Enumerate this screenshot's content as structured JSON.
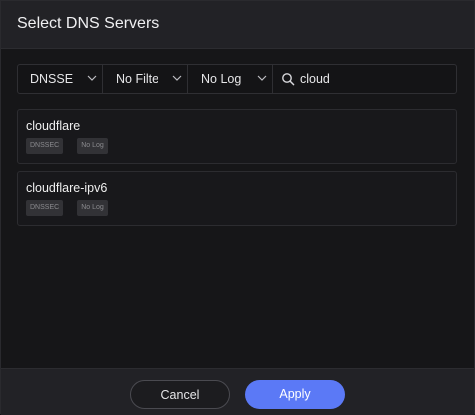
{
  "dialog": {
    "title": "Select DNS Servers"
  },
  "filters": {
    "dnssec": "DNSSE",
    "filter": "No Filte",
    "log": "No Log",
    "search_value": "cloud"
  },
  "servers": [
    {
      "name": "cloudflare",
      "badges": [
        "DNSSEC",
        "No Log"
      ]
    },
    {
      "name": "cloudflare-ipv6",
      "badges": [
        "DNSSEC",
        "No Log"
      ]
    }
  ],
  "footer": {
    "cancel_label": "Cancel",
    "apply_label": "Apply"
  },
  "colors": {
    "accent": "#5b79f6",
    "background": "#161618",
    "header": "#222226"
  }
}
